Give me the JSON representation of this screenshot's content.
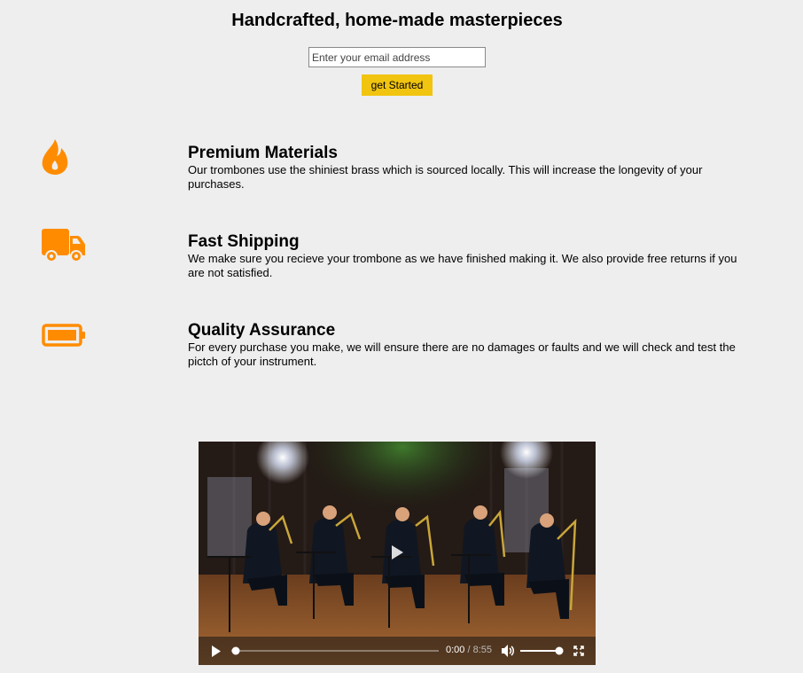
{
  "hero": {
    "title": "Handcrafted, home-made masterpieces",
    "email_placeholder": "Enter your email address",
    "button_label": "get Started"
  },
  "features": [
    {
      "icon": "fire-icon",
      "title": "Premium Materials",
      "desc": "Our trombones use the shiniest brass which is sourced locally. This will increase the longevity of your purchases."
    },
    {
      "icon": "truck-icon",
      "title": "Fast Shipping",
      "desc": "We make sure you recieve your trombone as we have finished making it. We also provide free returns if you are not satisfied."
    },
    {
      "icon": "battery-icon",
      "title": "Quality Assurance",
      "desc": "For every purchase you make, we will ensure there are no damages or faults and we will check and test the pictch of your instrument."
    }
  ],
  "video": {
    "current_time": "0:00",
    "separator": " / ",
    "duration": "8:55",
    "progress": 0,
    "volume": 1
  },
  "colors": {
    "accent": "#ff8c00",
    "button": "#f1c40f",
    "background": "#eeeeee"
  }
}
